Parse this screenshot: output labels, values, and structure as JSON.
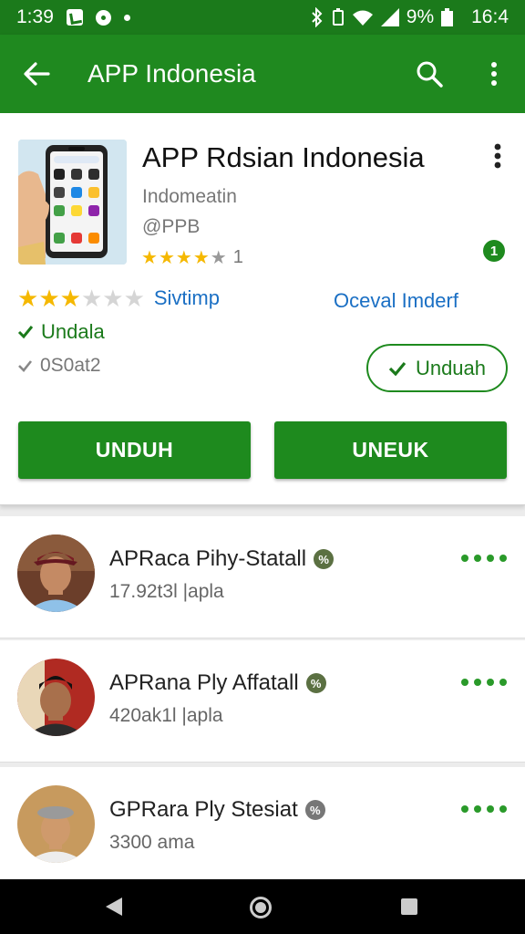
{
  "status_bar": {
    "time": "1:39",
    "battery": "9%",
    "clock": "16:4"
  },
  "app_bar": {
    "title": "APP Indonesia"
  },
  "app_card": {
    "title": "APP Rdsian Indonesia",
    "developer": "Indomeatin",
    "handle": "@PPB",
    "mini_rating": 4,
    "mini_count": "1",
    "badge": "1",
    "rating": 3,
    "rating_link": "Sivtimp",
    "right_link": "Oceval Imderf",
    "check_label": "Undala",
    "check_label_2": "0S0at2",
    "outline_button": "Unduah",
    "button_left": "UNDUH",
    "button_right": "UNEUK"
  },
  "users": [
    {
      "name": "APRaca Pihy-Statall",
      "sub": "17.92t3l |apla"
    },
    {
      "name": "APRana Ply Affatall",
      "sub": "420ak1l |apla"
    },
    {
      "name": "GPRara Ply Stesiat",
      "sub": "3300 ama"
    }
  ],
  "colors": {
    "app_bar": "#1f891f",
    "status_bar": "#1b7a1b",
    "accent": "#1e8a1e",
    "link": "#1a6fc4",
    "star": "#f5b800"
  }
}
